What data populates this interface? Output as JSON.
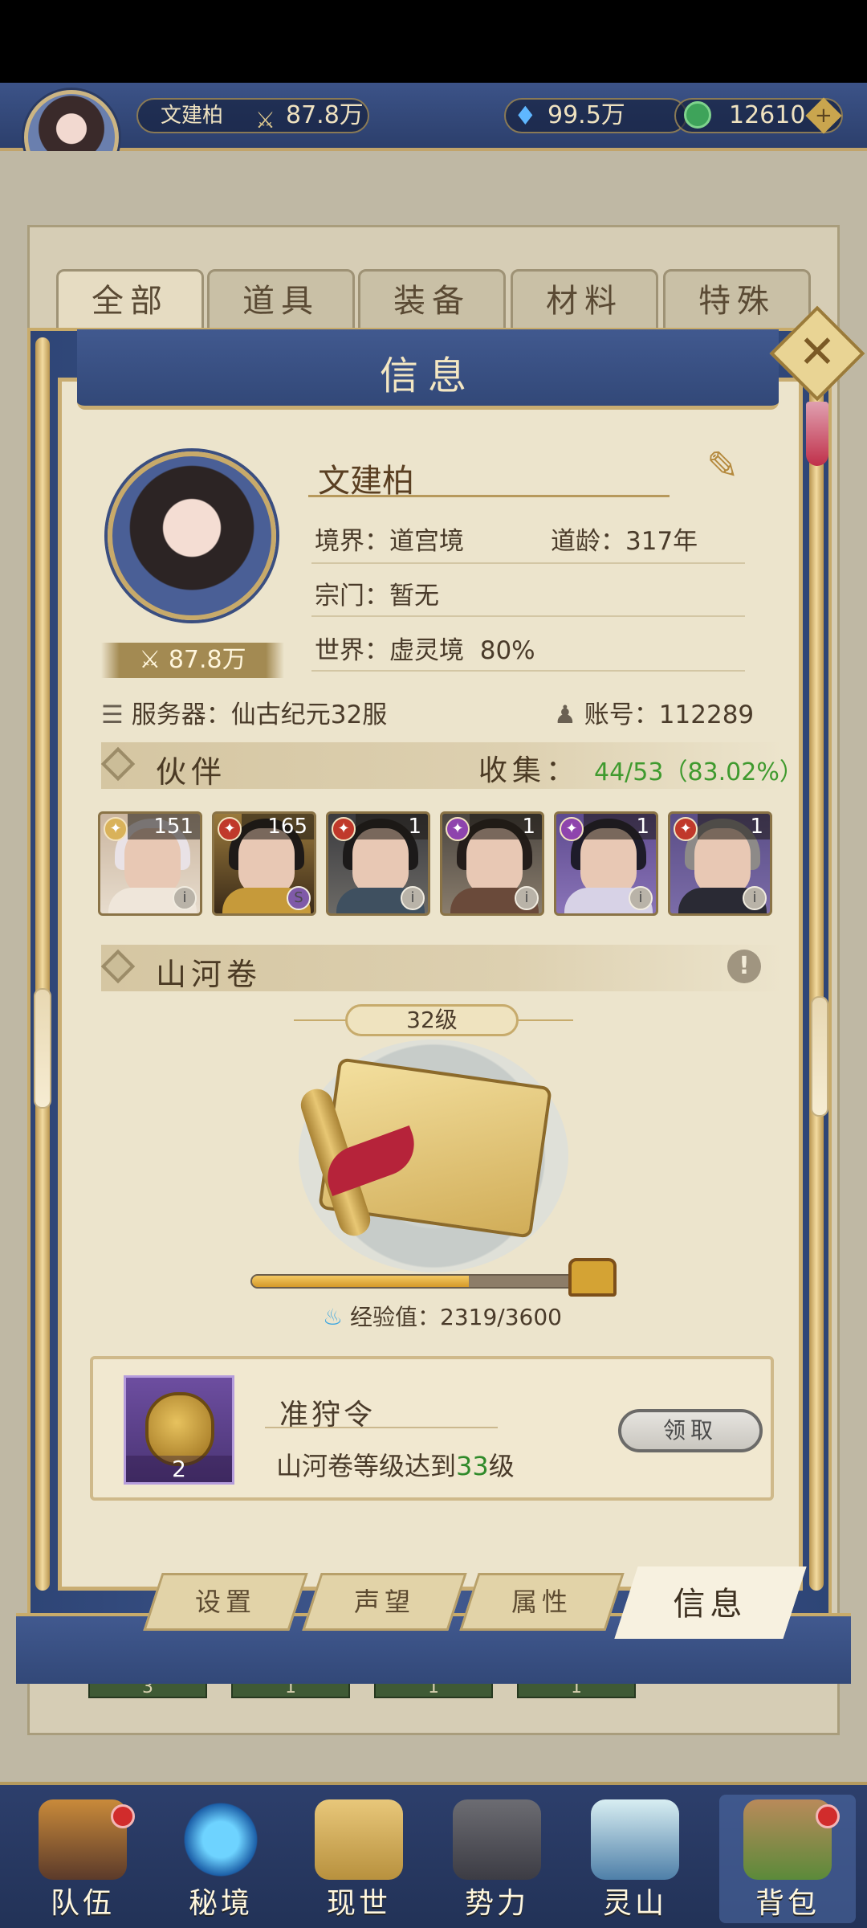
{
  "topbar": {
    "player_name": "文建柏",
    "power": "87.8万",
    "crystal": "99.5万",
    "jade": "12610",
    "add_symbol": "+"
  },
  "bag_tabs": [
    "全部",
    "道具",
    "装备",
    "材料",
    "特殊"
  ],
  "background_slots": [
    "3",
    "1",
    "1",
    "1"
  ],
  "modal": {
    "title": "信息",
    "close_symbol": "✕"
  },
  "profile": {
    "name": "文建柏",
    "power": "87.8万",
    "realm_label": "境界：",
    "realm": "道宫境",
    "age_label": "道龄：",
    "age": "317年",
    "sect_label": "宗门：",
    "sect": "暂无",
    "world_label": "世界：",
    "world": "虚灵境",
    "world_progress": "80%",
    "server_label": "服务器：",
    "server": "仙古纪元32服",
    "account_label": "账号：",
    "account": "112289"
  },
  "partners": {
    "title": "伙伴",
    "collect_label": "收集：",
    "collect_value": "44/53（83.02%）",
    "items": [
      {
        "level": "151",
        "element_color": "#d9b25a",
        "stars": 2
      },
      {
        "level": "165",
        "element_color": "#c0392b",
        "stars": 3
      },
      {
        "level": "1",
        "element_color": "#c0392b",
        "stars": 0
      },
      {
        "level": "1",
        "element_color": "#8e44ad",
        "stars": 0
      },
      {
        "level": "1",
        "element_color": "#8e44ad",
        "stars": 0
      },
      {
        "level": "1",
        "element_color": "#c0392b",
        "stars": 0
      }
    ]
  },
  "scroll": {
    "title": "山河卷",
    "alert": "!",
    "level": "32级",
    "exp_label": "经验值：",
    "exp_value": "2319/3600",
    "exp_fraction": 0.644
  },
  "reward": {
    "count": "2",
    "name": "准狩令",
    "desc_prefix": "山河卷等级达到",
    "desc_level": "33",
    "desc_suffix": "级",
    "claim_label": "领取"
  },
  "modal_tabs": [
    "设置",
    "声望",
    "属性",
    "信息"
  ],
  "bottom_nav": [
    "队伍",
    "秘境",
    "现世",
    "势力",
    "灵山",
    "背包"
  ],
  "colors": {
    "frame_blue": "#324878",
    "gold": "#c8ab6a",
    "parchment": "#ece4cc",
    "green_highlight": "#3f9a2e"
  }
}
